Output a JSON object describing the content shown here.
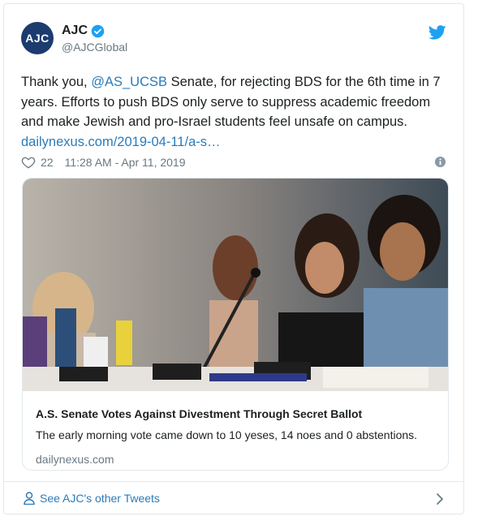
{
  "account": {
    "avatar_text": "AJC",
    "display_name": "AJC",
    "handle": "@AJCGlobal",
    "verified": true
  },
  "tweet": {
    "text_before_mention": "Thank you, ",
    "mention": "@AS_UCSB",
    "text_after_mention": " Senate, for rejecting BDS for the 6th time in 7 years. Efforts to push BDS only serve to suppress academic freedom and make Jewish and pro-Israel students feel unsafe on campus.",
    "link": "dailynexus.com/2019-04-11/a-s…",
    "likes": "22",
    "timestamp": "11:28 AM - Apr 11, 2019"
  },
  "link_card": {
    "title": "A.S. Senate Votes Against Divestment Through Secret Ballot",
    "description": "The early morning vote came down to 10 yeses, 14 noes and 0 abstentions.",
    "domain": "dailynexus.com",
    "image_alt_icon": "photo-students-at-senate-table"
  },
  "footer": {
    "label": "See AJC's other Tweets"
  },
  "colors": {
    "link": "#2b7bb9",
    "twitter_blue": "#1da1f2",
    "muted": "#697882",
    "border": "#e1e8ed",
    "avatar_bg": "#1c3b6e"
  }
}
